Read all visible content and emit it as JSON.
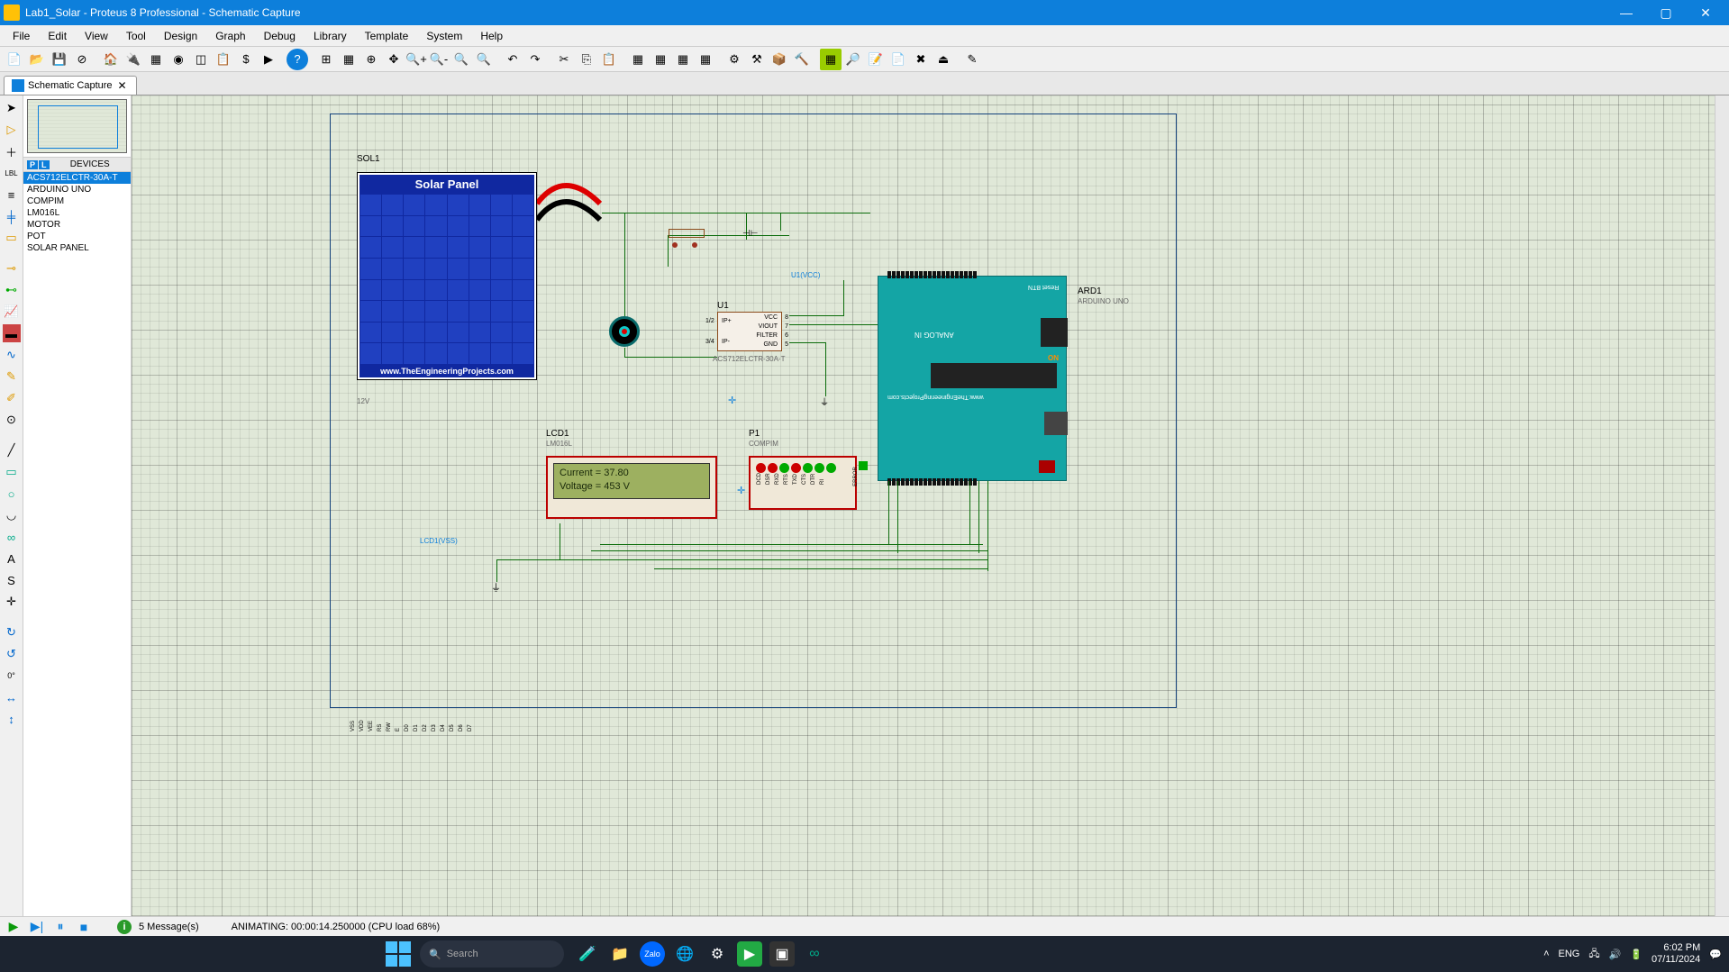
{
  "window": {
    "title": "Lab1_Solar - Proteus 8 Professional - Schematic Capture"
  },
  "menu": [
    "File",
    "Edit",
    "View",
    "Tool",
    "Design",
    "Graph",
    "Debug",
    "Library",
    "Template",
    "System",
    "Help"
  ],
  "tab": {
    "label": "Schematic Capture"
  },
  "devices": {
    "header": "DEVICES",
    "items": [
      "ACS712ELCTR-30A-T",
      "ARDUINO UNO",
      "COMPIM",
      "LM016L",
      "MOTOR",
      "POT",
      "SOLAR PANEL"
    ],
    "selectedIndex": 0
  },
  "components": {
    "sol1": {
      "ref": "SOL1",
      "title": "Solar Panel",
      "footer": "www.TheEngineeringProjects.com",
      "vlabel": "12V"
    },
    "u1": {
      "ref": "U1",
      "part": "ACS712ELCTR-30A-T",
      "pins_left": [
        "IP+",
        "IP-"
      ],
      "pins_right": [
        "VCC",
        "VIOUT",
        "FILTER",
        "GND"
      ],
      "net": "U1(VCC)"
    },
    "ard1": {
      "ref": "ARD1",
      "part": "ARDUINO UNO",
      "analog": "ANALOG IN",
      "brand": "www.TheEngineeringProjects.com",
      "reset": "Reset BTN",
      "on": "ON"
    },
    "lcd1": {
      "ref": "LCD1",
      "part": "LM016L",
      "line1": "Current = 37.80",
      "line2": "Voltage = 453 V",
      "net": "LCD1(VSS)"
    },
    "p1": {
      "ref": "P1",
      "part": "COMPIM",
      "error": "ERROR"
    }
  },
  "lcd_pins": [
    "VSS",
    "VDD",
    "VEE",
    "RS",
    "RW",
    "E",
    "D0",
    "D1",
    "D2",
    "D3",
    "D4",
    "D5",
    "D6",
    "D7"
  ],
  "compim_pins": [
    "DCD",
    "DSR",
    "RXD",
    "RTS",
    "TXD",
    "CTS",
    "DTR",
    "RI"
  ],
  "simulation": {
    "messages": "5 Message(s)",
    "status": "ANIMATING: 00:00:14.250000 (CPU load 68%)"
  },
  "taskbar": {
    "search_placeholder": "Search",
    "lang": "ENG",
    "time": "6:02 PM",
    "date": "07/11/2024"
  },
  "rotation": "0°"
}
